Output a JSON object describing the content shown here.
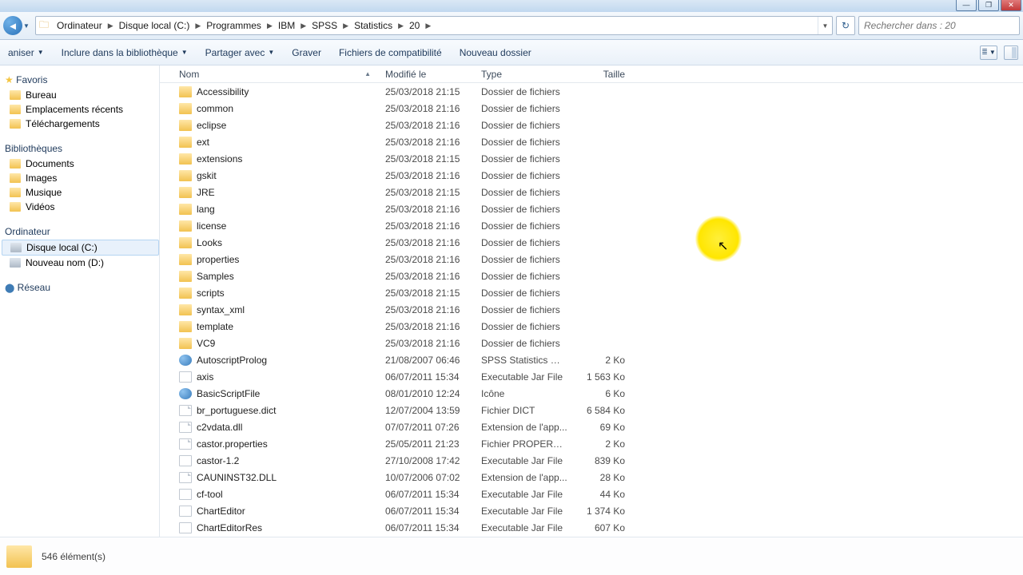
{
  "window": {
    "min": "—",
    "max": "❐",
    "close": "✕"
  },
  "breadcrumbs": [
    "Ordinateur",
    "Disque local (C:)",
    "Programmes",
    "IBM",
    "SPSS",
    "Statistics",
    "20"
  ],
  "search": {
    "placeholder": "Rechercher dans : 20"
  },
  "toolbar": {
    "organize": "aniser",
    "include": "Inclure dans la bibliothèque",
    "share": "Partager avec",
    "burn": "Graver",
    "compat": "Fichiers de compatibilité",
    "newfolder": "Nouveau dossier"
  },
  "sidebar": {
    "favorites": {
      "head": "Favoris",
      "items": [
        "Bureau",
        "Emplacements récents",
        "Téléchargements"
      ]
    },
    "libraries": {
      "head": "Bibliothèques",
      "items": [
        "Documents",
        "Images",
        "Musique",
        "Vidéos"
      ]
    },
    "computer": {
      "head": "Ordinateur",
      "items": [
        "Disque local (C:)",
        "Nouveau nom (D:)"
      ]
    },
    "network": {
      "head": "Réseau"
    }
  },
  "columns": {
    "name": "Nom",
    "modified": "Modifié le",
    "type": "Type",
    "size": "Taille"
  },
  "rows": [
    {
      "icon": "folder",
      "name": "Accessibility",
      "mod": "25/03/2018 21:15",
      "type": "Dossier de fichiers",
      "size": ""
    },
    {
      "icon": "folder",
      "name": "common",
      "mod": "25/03/2018 21:16",
      "type": "Dossier de fichiers",
      "size": ""
    },
    {
      "icon": "folder",
      "name": "eclipse",
      "mod": "25/03/2018 21:16",
      "type": "Dossier de fichiers",
      "size": ""
    },
    {
      "icon": "folder",
      "name": "ext",
      "mod": "25/03/2018 21:16",
      "type": "Dossier de fichiers",
      "size": ""
    },
    {
      "icon": "folder",
      "name": "extensions",
      "mod": "25/03/2018 21:15",
      "type": "Dossier de fichiers",
      "size": ""
    },
    {
      "icon": "folder",
      "name": "gskit",
      "mod": "25/03/2018 21:16",
      "type": "Dossier de fichiers",
      "size": ""
    },
    {
      "icon": "folder",
      "name": "JRE",
      "mod": "25/03/2018 21:15",
      "type": "Dossier de fichiers",
      "size": ""
    },
    {
      "icon": "folder",
      "name": "lang",
      "mod": "25/03/2018 21:16",
      "type": "Dossier de fichiers",
      "size": ""
    },
    {
      "icon": "folder",
      "name": "license",
      "mod": "25/03/2018 21:16",
      "type": "Dossier de fichiers",
      "size": ""
    },
    {
      "icon": "folder",
      "name": "Looks",
      "mod": "25/03/2018 21:16",
      "type": "Dossier de fichiers",
      "size": ""
    },
    {
      "icon": "folder",
      "name": "properties",
      "mod": "25/03/2018 21:16",
      "type": "Dossier de fichiers",
      "size": ""
    },
    {
      "icon": "folder",
      "name": "Samples",
      "mod": "25/03/2018 21:16",
      "type": "Dossier de fichiers",
      "size": ""
    },
    {
      "icon": "folder",
      "name": "scripts",
      "mod": "25/03/2018 21:15",
      "type": "Dossier de fichiers",
      "size": ""
    },
    {
      "icon": "folder",
      "name": "syntax_xml",
      "mod": "25/03/2018 21:16",
      "type": "Dossier de fichiers",
      "size": ""
    },
    {
      "icon": "folder",
      "name": "template",
      "mod": "25/03/2018 21:16",
      "type": "Dossier de fichiers",
      "size": ""
    },
    {
      "icon": "folder",
      "name": "VC9",
      "mod": "25/03/2018 21:16",
      "type": "Dossier de fichiers",
      "size": ""
    },
    {
      "icon": "blue",
      "name": "AutoscriptProlog",
      "mod": "21/08/2007 06:46",
      "type": "SPSS Statistics Wi...",
      "size": "2 Ko"
    },
    {
      "icon": "jar",
      "name": "axis",
      "mod": "06/07/2011 15:34",
      "type": "Executable Jar File",
      "size": "1 563 Ko"
    },
    {
      "icon": "blue",
      "name": "BasicScriptFile",
      "mod": "08/01/2010 12:24",
      "type": "Icône",
      "size": "6 Ko"
    },
    {
      "icon": "file",
      "name": "br_portuguese.dict",
      "mod": "12/07/2004 13:59",
      "type": "Fichier DICT",
      "size": "6 584 Ko"
    },
    {
      "icon": "file",
      "name": "c2vdata.dll",
      "mod": "07/07/2011 07:26",
      "type": "Extension de l'app...",
      "size": "69 Ko"
    },
    {
      "icon": "file",
      "name": "castor.properties",
      "mod": "25/05/2011 21:23",
      "type": "Fichier PROPERTIES",
      "size": "2 Ko"
    },
    {
      "icon": "jar",
      "name": "castor-1.2",
      "mod": "27/10/2008 17:42",
      "type": "Executable Jar File",
      "size": "839 Ko"
    },
    {
      "icon": "file",
      "name": "CAUNINST32.DLL",
      "mod": "10/07/2006 07:02",
      "type": "Extension de l'app...",
      "size": "28 Ko"
    },
    {
      "icon": "jar",
      "name": "cf-tool",
      "mod": "06/07/2011 15:34",
      "type": "Executable Jar File",
      "size": "44 Ko"
    },
    {
      "icon": "jar",
      "name": "ChartEditor",
      "mod": "06/07/2011 15:34",
      "type": "Executable Jar File",
      "size": "1 374 Ko"
    },
    {
      "icon": "jar",
      "name": "ChartEditorRes",
      "mod": "06/07/2011 15:34",
      "type": "Executable Jar File",
      "size": "607 Ko"
    }
  ],
  "status": {
    "count": "546 élément(s)"
  }
}
